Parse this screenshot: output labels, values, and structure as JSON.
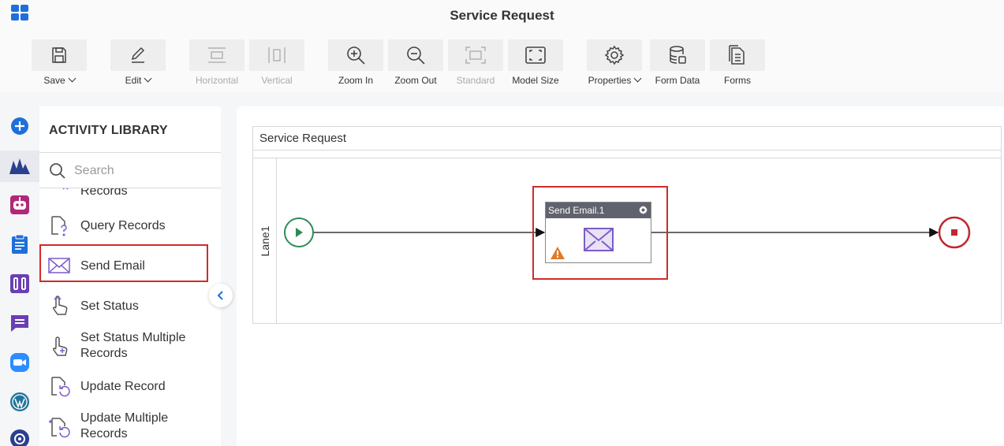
{
  "app": {
    "title": "Service Request"
  },
  "toolbar": {
    "buttons": [
      {
        "label": "Save",
        "icon": "save-icon",
        "dropdown": true,
        "disabled": false
      },
      {
        "label": "Edit",
        "icon": "edit-icon",
        "dropdown": true,
        "disabled": false
      },
      {
        "label": "Horizontal",
        "icon": "horizontal-icon",
        "dropdown": false,
        "disabled": true
      },
      {
        "label": "Vertical",
        "icon": "vertical-icon",
        "dropdown": false,
        "disabled": true
      },
      {
        "label": "Zoom In",
        "icon": "zoom-in-icon",
        "dropdown": false,
        "disabled": false
      },
      {
        "label": "Zoom Out",
        "icon": "zoom-out-icon",
        "dropdown": false,
        "disabled": false
      },
      {
        "label": "Standard",
        "icon": "standard-icon",
        "dropdown": false,
        "disabled": true
      },
      {
        "label": "Model Size",
        "icon": "model-size-icon",
        "dropdown": false,
        "disabled": false
      },
      {
        "label": "Properties",
        "icon": "gear-icon",
        "dropdown": true,
        "disabled": false
      },
      {
        "label": "Form Data",
        "icon": "database-icon",
        "dropdown": false,
        "disabled": false
      },
      {
        "label": "Forms",
        "icon": "forms-icon",
        "dropdown": false,
        "disabled": false
      }
    ]
  },
  "rail": {
    "items": [
      {
        "icon": "plus-circle-icon",
        "color": "#1e6fd9",
        "active": false
      },
      {
        "icon": "process-icon",
        "color": "#2a3f8f",
        "active": true
      },
      {
        "icon": "bot-icon",
        "color": "#b0287a",
        "active": false
      },
      {
        "icon": "clipboard-icon",
        "color": "#1e6fd9",
        "active": false
      },
      {
        "icon": "integration-icon",
        "color": "#6a3fb5",
        "active": false
      },
      {
        "icon": "chat-icon",
        "color": "#6a3fb5",
        "active": false
      },
      {
        "icon": "video-icon",
        "color": "#2d8cff",
        "active": false
      },
      {
        "icon": "wordpress-icon",
        "color": "#21759b",
        "active": false
      },
      {
        "icon": "more-icon",
        "color": "#2a3f8f",
        "active": false
      }
    ]
  },
  "library": {
    "title": "ACTIVITY LIBRARY",
    "search_placeholder": "Search",
    "items": [
      {
        "label": "Records",
        "icon": "delete-records-icon"
      },
      {
        "label": "Query Records",
        "icon": "query-records-icon"
      },
      {
        "label": "Send Email",
        "icon": "send-email-icon"
      },
      {
        "label": "Set Status",
        "icon": "set-status-icon"
      },
      {
        "label": "Set Status Multiple Records",
        "icon": "set-status-multiple-icon"
      },
      {
        "label": "Update Record",
        "icon": "update-record-icon"
      },
      {
        "label": "Update Multiple Records",
        "icon": "update-multiple-icon"
      }
    ]
  },
  "canvas": {
    "pool_title": "Service Request",
    "lane_label": "Lane1",
    "task": {
      "title": "Send Email.1",
      "icon": "envelope-icon",
      "warning_icon": "warning-icon"
    },
    "colors": {
      "start": "#2e8b57",
      "end": "#c0282d",
      "task_header": "#60636e",
      "highlight": "#d02b2b",
      "accent": "#7b5cc7"
    }
  }
}
